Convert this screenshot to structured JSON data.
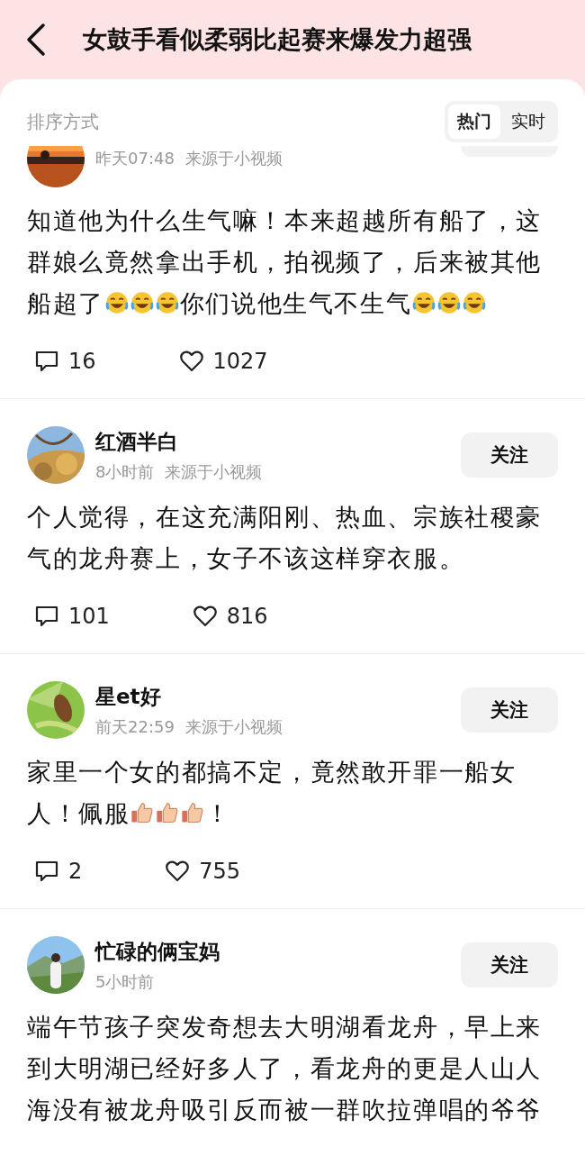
{
  "header": {
    "title": "女鼓手看似柔弱比起赛来爆发力超强"
  },
  "sort": {
    "label": "排序方式",
    "options": [
      {
        "label": "热门",
        "selected": true
      },
      {
        "label": "实时",
        "selected": false
      }
    ]
  },
  "comments": [
    {
      "partial": true,
      "meta": [
        "昨天07:48",
        "来源于小视频"
      ],
      "segments": [
        {
          "kind": "text",
          "text": "知道他为什么生气嘛！本来超越所有船了，这群娘么竟然拿出手机，拍视频了，后来被其他船超了"
        },
        {
          "kind": "laugh"
        },
        {
          "kind": "laugh"
        },
        {
          "kind": "laugh"
        },
        {
          "kind": "text",
          "text": "你们说他生气不生气"
        },
        {
          "kind": "laugh"
        },
        {
          "kind": "laugh"
        },
        {
          "kind": "laugh"
        }
      ],
      "replies": "16",
      "likes": "1027"
    },
    {
      "partial": false,
      "name": "红酒半白",
      "follow": "关注",
      "meta": [
        "8小时前",
        "来源于小视频"
      ],
      "segments": [
        {
          "kind": "text",
          "text": "个人觉得，在这充满阳刚、热血、宗族社稷豪气的龙舟赛上，女子不该这样穿衣服。"
        }
      ],
      "replies": "101",
      "likes": "816"
    },
    {
      "partial": false,
      "name": "星et好",
      "follow": "关注",
      "meta": [
        "前天22:59",
        "来源于小视频"
      ],
      "segments": [
        {
          "kind": "text",
          "text": "家里一个女的都搞不定，竟然敢开罪一船女人！佩服"
        },
        {
          "kind": "thumb"
        },
        {
          "kind": "thumb"
        },
        {
          "kind": "thumb"
        },
        {
          "kind": "text",
          "text": "！"
        }
      ],
      "replies": "2",
      "likes": "755"
    },
    {
      "partial": false,
      "name": "忙碌的俩宝妈",
      "follow": "关注",
      "meta": [
        "5小时前"
      ],
      "segments": [
        {
          "kind": "text",
          "text": "端午节孩子突发奇想去大明湖看龙舟，早上来到大明湖已经好多人了，看龙舟的更是人山人海没有被龙舟吸引反而被一群吹拉弹唱的爷爷"
        }
      ]
    }
  ]
}
